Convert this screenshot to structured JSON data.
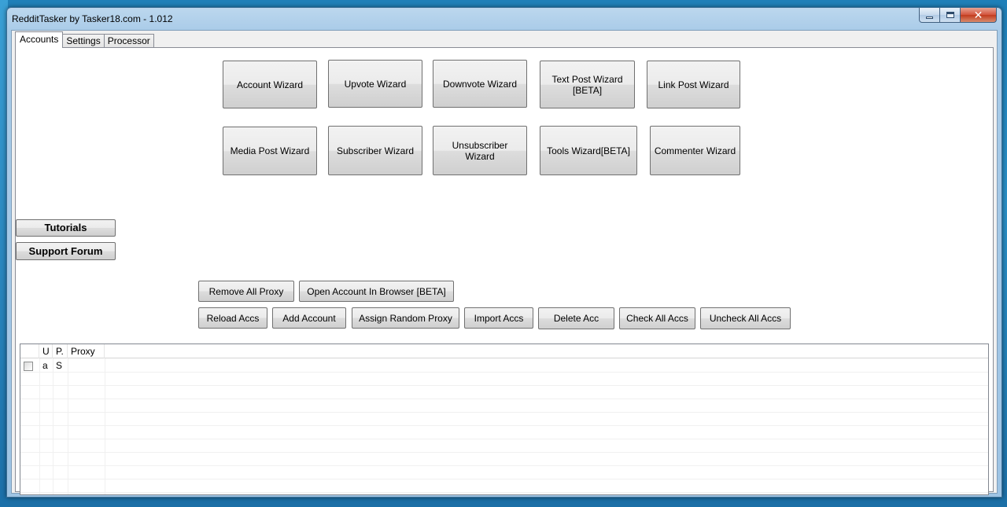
{
  "window": {
    "title": "RedditTasker by Tasker18.com - 1.012"
  },
  "tabs": [
    {
      "label": "Accounts"
    },
    {
      "label": "Settings"
    },
    {
      "label": "Processor"
    }
  ],
  "wizards": {
    "account": "Account Wizard",
    "upvote": "Upvote Wizard",
    "downvote": "Downvote Wizard",
    "text_post": "Text Post Wizard [BETA]",
    "link_post": "Link Post Wizard",
    "media_post": "Media Post Wizard",
    "subscriber": "Subscriber Wizard",
    "unsubscriber": "Unsubscriber Wizard",
    "tools": "Tools Wizard[BETA]",
    "commenter": "Commenter Wizard"
  },
  "side": {
    "tutorials": "Tutorials",
    "support_forum": "Support Forum"
  },
  "actions": {
    "remove_all_proxy": "Remove All Proxy",
    "open_account_in_browser": "Open Account In Browser [BETA]",
    "reload_accs": "Reload Accs",
    "add_account": "Add Account",
    "assign_random_proxy": "Assign Random Proxy",
    "import_accs": "Import Accs",
    "delete_acc": "Delete Acc",
    "check_all_accs": "Check All Accs",
    "uncheck_all_accs": "Uncheck All Accs"
  },
  "grid": {
    "columns": [
      "",
      "U",
      "P.",
      "Proxy"
    ],
    "rows": [
      {
        "checked": false,
        "u": "a",
        "p": "S",
        "proxy": ""
      }
    ]
  },
  "colors": {
    "window_frame": "#a9cbe8",
    "close_button": "#c23b1d",
    "button_face": "#e5e5e5"
  }
}
